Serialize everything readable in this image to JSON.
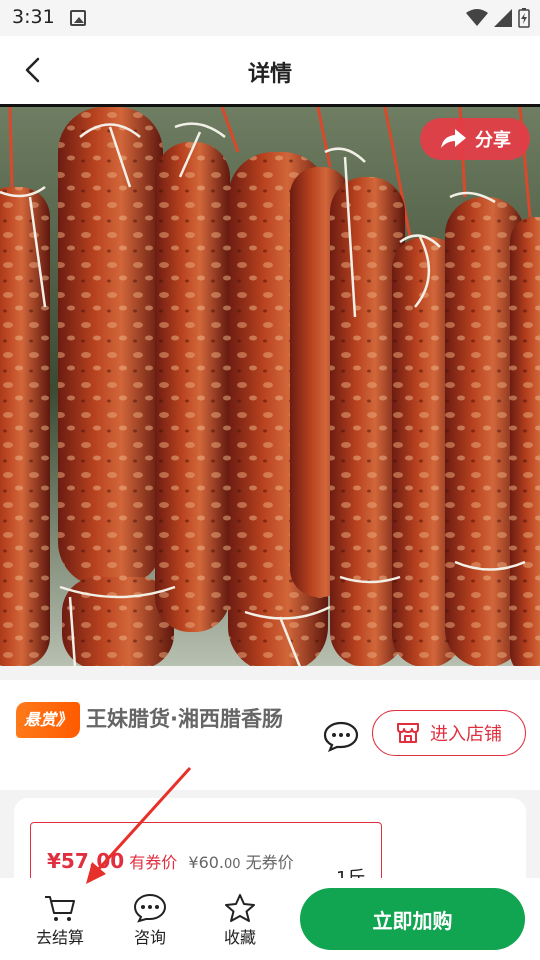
{
  "status_bar": {
    "time": "3:31"
  },
  "header": {
    "title": "详情"
  },
  "hero": {
    "share_label": "分享"
  },
  "product": {
    "reward_tag": "悬赏》",
    "title": "王妹腊货·湘西腊香肠",
    "store_button": "进入店铺"
  },
  "price": {
    "coupon_price": "¥57.00",
    "coupon_label": "有券价",
    "original_price_symbol": "¥60.",
    "original_price_decimal": "00",
    "original_label": "无券价",
    "unit": "1斤"
  },
  "bottom_bar": {
    "checkout": "去结算",
    "consult": "咨询",
    "favorite": "收藏",
    "add_to_cart": "立即加购"
  },
  "colors": {
    "accent_red": "#e03040",
    "primary_green": "#11a451",
    "reward_orange": "#ff6a10"
  }
}
